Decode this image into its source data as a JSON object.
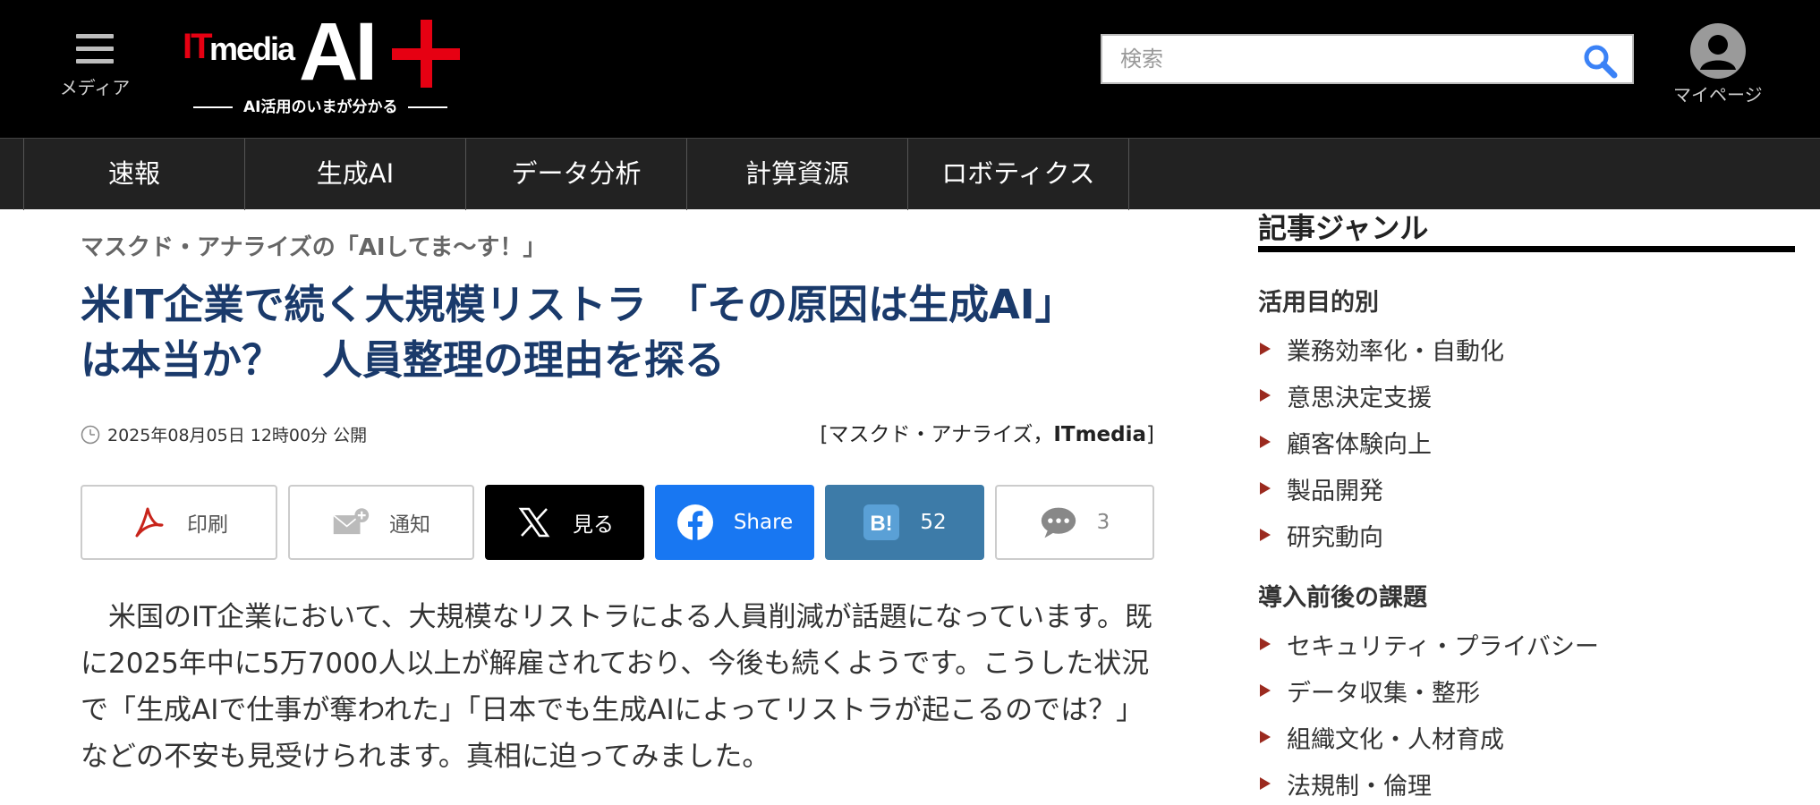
{
  "header": {
    "menu_label": "メディア",
    "logo": {
      "it": "IT",
      "media": "media",
      "ai": "AI",
      "tagline": "AI活用のいまが分かる"
    },
    "search_placeholder": "検索",
    "mypage_label": "マイページ",
    "colors": {
      "background": "#000000",
      "brand_red": "#e60012",
      "search_icon": "#3b82f6"
    }
  },
  "nav": {
    "items": [
      "速報",
      "生成AI",
      "データ分析",
      "計算資源",
      "ロボティクス"
    ]
  },
  "article": {
    "series": "マスクド・アナライズの「AIしてま〜す！」",
    "title_line1": "米IT企業で続く大規模リストラ　「その原因は生成AI」",
    "title_line2": "は本当か？　人員整理の理由を探る",
    "date": "2025年08月05日 12時00分 公開",
    "byline_author": "[マスクド・アナライズ，",
    "byline_org": "ITmedia",
    "byline_close": "]",
    "share": {
      "print": "印刷",
      "notify": "通知",
      "x": "見る",
      "facebook": "Share",
      "hatena": "52",
      "comments": "3"
    },
    "lead": "　米国のIT企業において、大規模なリストラによる人員削減が話題になっています。既に2025年中に5万7000人以上が解雇されており、今後も続くようです。こうした状況で「生成AIで仕事が奪われた」「日本でも生成AIによってリストラが起こるのでは？」などの不安も見受けられます。真相に迫ってみました。"
  },
  "sidebar": {
    "heading": "記事ジャンル",
    "sections": [
      {
        "title": "活用目的別",
        "items": [
          "業務効率化・自動化",
          "意思決定支援",
          "顧客体験向上",
          "製品開発",
          "研究動向"
        ]
      },
      {
        "title": "導入前後の課題",
        "items": [
          "セキュリティ・プライバシー",
          "データ収集・整形",
          "組織文化・人材育成",
          "法規制・倫理"
        ]
      }
    ],
    "colors": {
      "arrow": "#9b2a1f"
    }
  }
}
